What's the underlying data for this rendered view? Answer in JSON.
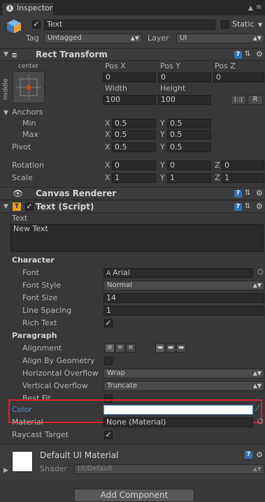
{
  "tab": {
    "title": "Inspector"
  },
  "object": {
    "name": "Text",
    "static_label": "Static",
    "tag_label": "Tag",
    "tag_value": "Untagged",
    "layer_label": "Layer",
    "layer_value": "UI"
  },
  "rect_transform": {
    "title": "Rect Transform",
    "anchor_h": "center",
    "anchor_v": "middle",
    "posx_label": "Pos X",
    "posy_label": "Pos Y",
    "posz_label": "Pos Z",
    "posx": "0",
    "posy": "0",
    "posz": "0",
    "width_label": "Width",
    "height_label": "Height",
    "width": "100",
    "height": "100",
    "r_button": "R",
    "anchors_label": "Anchors",
    "min_label": "Min",
    "max_label": "Max",
    "pivot_label": "Pivot",
    "min_x": "0.5",
    "min_y": "0.5",
    "max_x": "0.5",
    "max_y": "0.5",
    "pivot_x": "0.5",
    "pivot_y": "0.5",
    "rotation_label": "Rotation",
    "scale_label": "Scale",
    "rot_x": "0",
    "rot_y": "0",
    "rot_z": "0",
    "scale_x": "1",
    "scale_y": "1",
    "scale_z": "1",
    "x": "X",
    "y": "Y",
    "z": "Z"
  },
  "canvas_renderer": {
    "title": "Canvas Renderer"
  },
  "text_script": {
    "title": "Text (Script)",
    "text_label": "Text",
    "text_value": "New Text",
    "character_label": "Character",
    "font_label": "Font",
    "font_value": "Arial",
    "font_style_label": "Font Style",
    "font_style_value": "Normal",
    "font_size_label": "Font Size",
    "font_size_value": "14",
    "line_spacing_label": "Line Spacing",
    "line_spacing_value": "1",
    "rich_text_label": "Rich Text",
    "paragraph_label": "Paragraph",
    "alignment_label": "Alignment",
    "align_by_geometry_label": "Align By Geometry",
    "h_overflow_label": "Horizontal Overflow",
    "h_overflow_value": "Wrap",
    "v_overflow_label": "Vertical Overflow",
    "v_overflow_value": "Truncate",
    "best_fit_label": "Best Fit",
    "color_label": "Color",
    "material_label": "Material",
    "material_value": "None (Material)",
    "raycast_label": "Raycast Target"
  },
  "material": {
    "name": "Default UI Material",
    "shader_label": "Shader",
    "shader_value": "UI/Default"
  },
  "add_component": "Add Component",
  "colors": {
    "background": "#383838",
    "highlight_box": "#e0202a",
    "color_label": "#5b8fdf",
    "color_swatch": "#ffffff"
  }
}
